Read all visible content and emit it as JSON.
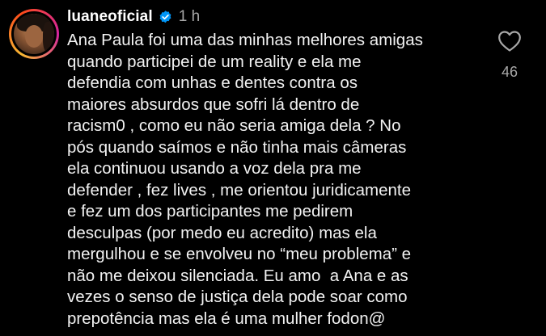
{
  "comment": {
    "username": "luaneoficial",
    "timestamp": "1 h",
    "verified_icon": "verified-badge-icon",
    "like_icon": "heart-outline-icon",
    "like_count": "46",
    "lines": [
      "Ana Paula foi uma das minhas melhores amigas",
      "quando participei de um reality e ela me",
      "defendia com unhas e dentes contra os",
      "maiores absurdos que sofri lá dentro de",
      "racism0 , como eu não seria amiga dela ? No",
      "pós quando saímos e não tinha mais câmeras",
      "ela continuou usando a voz dela pra me",
      "defender , fez lives , me orientou juridicamente",
      "e fez um dos participantes me pedirem",
      "desculpas (por medo eu acredito) mas ela",
      "mergulhou e se envolveu no “meu problema” e",
      "não me deixou silenciada. Eu amo  a Ana e as",
      "vezes o senso de justiça dela pode soar como",
      "prepotência mas ela é uma mulher fodon@"
    ]
  },
  "colors": {
    "background": "#000000",
    "text": "#f2f2f2",
    "muted": "#a8a8a8",
    "verified_blue": "#0095f6"
  }
}
